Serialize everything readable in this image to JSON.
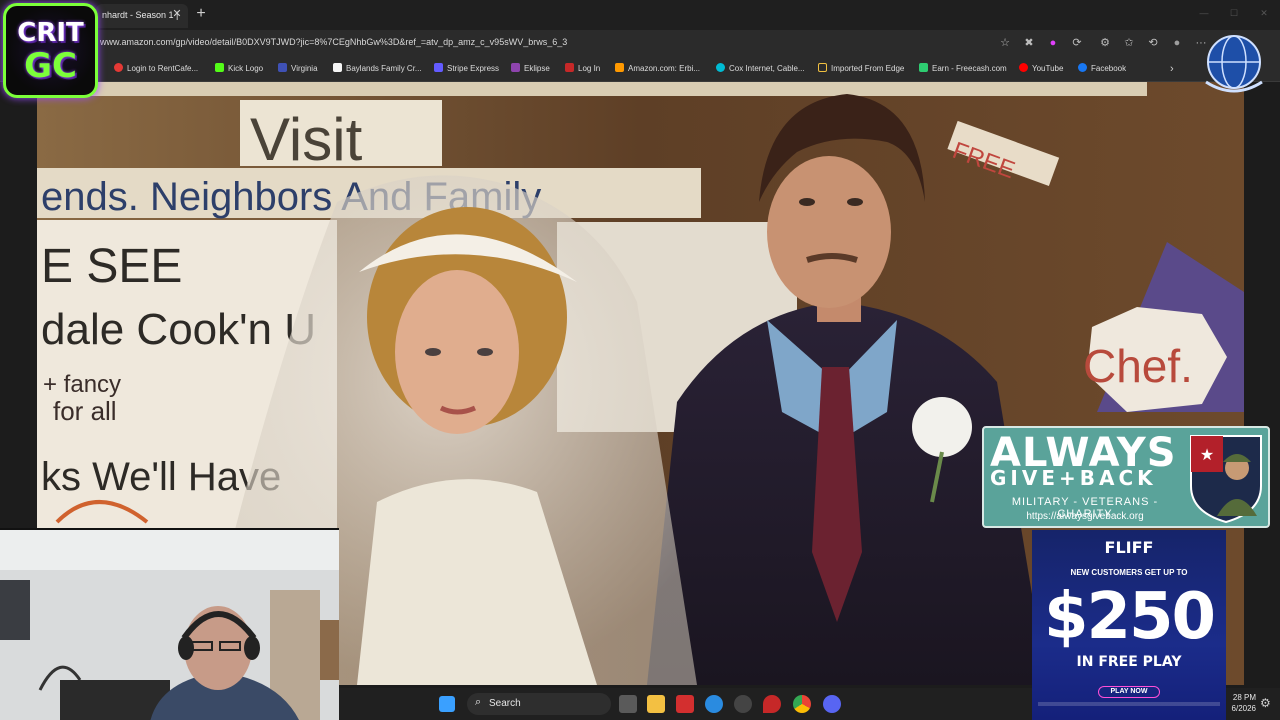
{
  "browser": {
    "tab_title": "nhardt - Season 1 |",
    "tab_close": "✕",
    "new_tab": "+",
    "url": "www.amazon.com/gp/video/detail/B0DXV9TJWD?jic=8%7CEgNhbGw%3D&ref_=atv_dp_amz_c_v95sWV_brws_6_3",
    "window_controls": [
      "—",
      "☐",
      "✕"
    ],
    "more_icon": "···"
  },
  "bookmarks": [
    {
      "label": "Login to RentCafe...",
      "color": "#e53935"
    },
    {
      "label": "Kick Logo",
      "color": "#53fc18"
    },
    {
      "label": "Virginia",
      "color": "#3f51b5"
    },
    {
      "label": "Baylands Family Cr...",
      "color": "#f5f5f5"
    },
    {
      "label": "Stripe Express",
      "color": "#635bff"
    },
    {
      "label": "Eklipse",
      "color": "#8e44ad"
    },
    {
      "label": "Log In",
      "color": "#c62828"
    },
    {
      "label": "Amazon.com: Erbi...",
      "color": "#ff9900"
    },
    {
      "label": "Cox Internet, Cable...",
      "color": "#00bcd4"
    },
    {
      "label": "Imported From Edge",
      "color": "#f0c040"
    },
    {
      "label": "Earn - Freecash.com",
      "color": "#2ecc71"
    },
    {
      "label": "YouTube",
      "color": "#ff0000"
    },
    {
      "label": "Facebook",
      "color": "#1877f2"
    }
  ],
  "logo": {
    "line1": "CRIT",
    "line2": "GC"
  },
  "photo_signs": {
    "visit": "Visit",
    "friends": "ends. Neighbors And Family",
    "see": "E SEE",
    "cook": "dale Cook'n U",
    "fancy": "+ fancy",
    "for_all": "for all",
    "well": "ks We'll Have",
    "free": "FREE",
    "chef": "Chef."
  },
  "always_give_back": {
    "title": "ALWAYS",
    "subtitle": "GIVE+BACK",
    "tagline": "MILITARY - VETERANS - CHARITY",
    "url": "https://alwaysgiveback.org"
  },
  "fliff": {
    "logo": "FLIFF",
    "headline": "NEW CUSTOMERS GET UP TO",
    "amount": "$250",
    "free_play": "IN FREE PLAY",
    "cta": "PLAY NOW"
  },
  "taskbar": {
    "search_label": "Search",
    "time": "28 PM",
    "date": "6/2026"
  }
}
